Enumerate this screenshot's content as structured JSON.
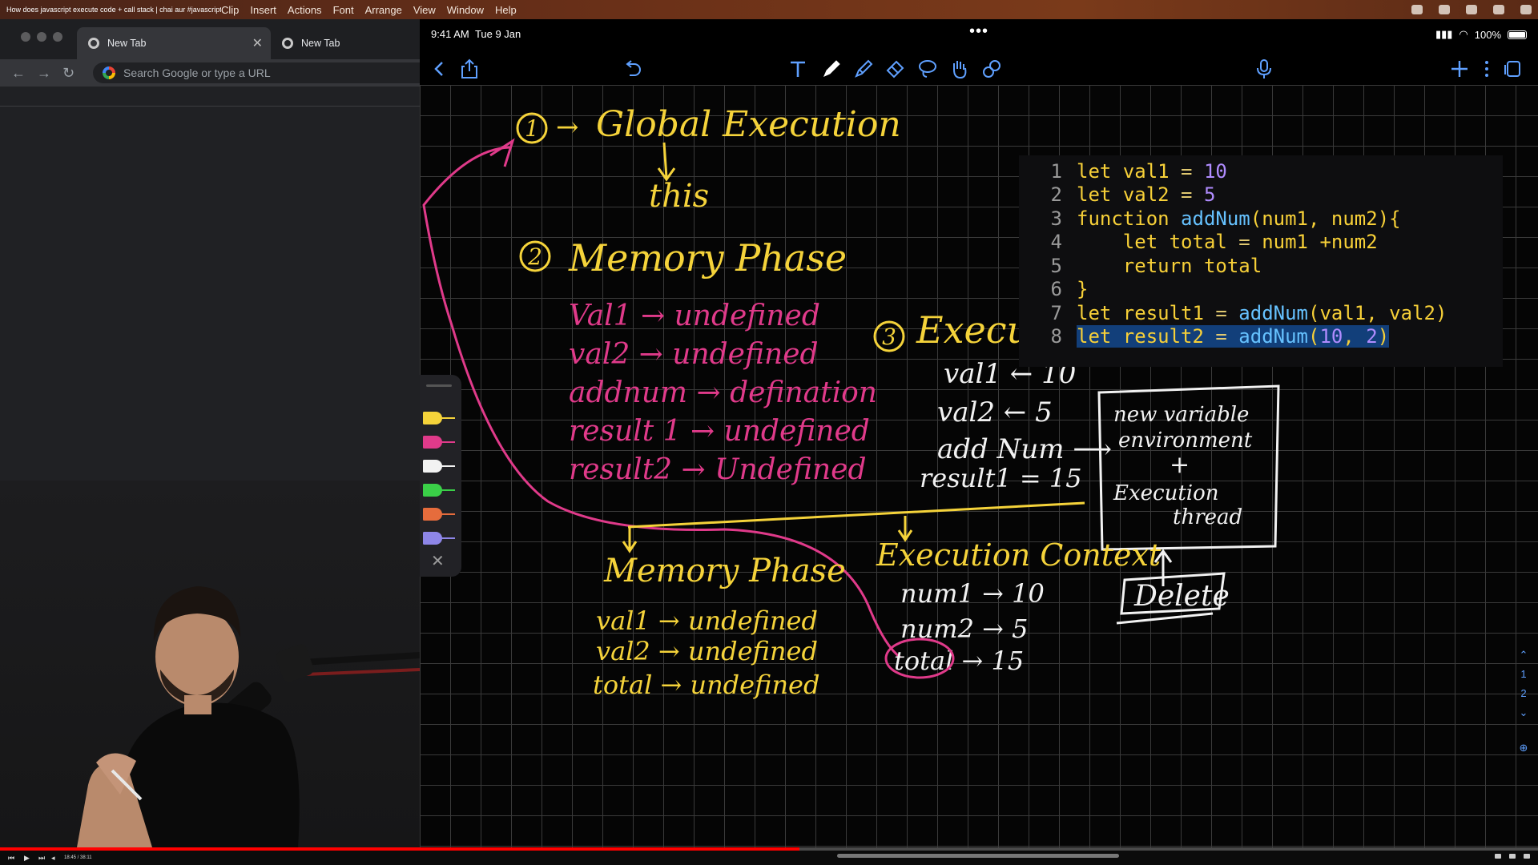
{
  "menubar": {
    "video_title": "How does javascript execute code + call stack | chai aur #javascript",
    "items": [
      "Clip",
      "Insert",
      "Actions",
      "Font",
      "Arrange",
      "View",
      "Window",
      "Help"
    ]
  },
  "chrome": {
    "tabs": [
      {
        "title": "New Tab",
        "active": true
      },
      {
        "title": "New Tab",
        "active": false
      }
    ],
    "omnibox_placeholder": "Search Google or type a URL"
  },
  "ipad": {
    "time": "9:41 AM",
    "date": "Tue 9 Jan",
    "battery": "100%",
    "toolbar_icons": [
      "back-icon",
      "share-icon",
      "undo-icon",
      "text-tool-icon",
      "pen-tool-icon",
      "highlighter-icon",
      "eraser-icon",
      "lasso-icon",
      "hand-icon",
      "shapes-icon",
      "microphone-icon",
      "add-icon",
      "more-icon",
      "pages-icon"
    ]
  },
  "code": {
    "lines": [
      {
        "n": "1",
        "tokens": [
          [
            "kw",
            "let "
          ],
          [
            "id",
            "val1 "
          ],
          [
            "op",
            "= "
          ],
          [
            "num",
            "10"
          ]
        ]
      },
      {
        "n": "2",
        "tokens": [
          [
            "kw",
            "let "
          ],
          [
            "id",
            "val2 "
          ],
          [
            "op",
            "= "
          ],
          [
            "num",
            "5"
          ]
        ]
      },
      {
        "n": "3",
        "tokens": [
          [
            "kw",
            "function "
          ],
          [
            "call",
            "addNum"
          ],
          [
            "id",
            "(num1, num2){"
          ]
        ]
      },
      {
        "n": "4",
        "tokens": [
          [
            "kw",
            "    let "
          ],
          [
            "id",
            "total "
          ],
          [
            "op",
            "= "
          ],
          [
            "id",
            "num1 +num2"
          ]
        ]
      },
      {
        "n": "5",
        "tokens": [
          [
            "kw",
            "    return "
          ],
          [
            "id",
            "total"
          ]
        ]
      },
      {
        "n": "6",
        "tokens": [
          [
            "id",
            "}"
          ]
        ]
      },
      {
        "n": "7",
        "tokens": [
          [
            "kw",
            "let "
          ],
          [
            "id",
            "result1 "
          ],
          [
            "op",
            "= "
          ],
          [
            "call",
            "addNum"
          ],
          [
            "id",
            "(val1, val2)"
          ]
        ]
      },
      {
        "n": "8",
        "tokens": [
          [
            "kw",
            "let "
          ],
          [
            "id",
            "result2 "
          ],
          [
            "op",
            "= "
          ],
          [
            "call",
            "addNum"
          ],
          [
            "id",
            "("
          ],
          [
            "num",
            "10"
          ],
          [
            "id",
            ", "
          ],
          [
            "num",
            "2"
          ],
          [
            "id",
            ")"
          ]
        ],
        "highlight": true
      }
    ]
  },
  "notes": {
    "global_title": "Global Execution",
    "global_num": "1",
    "global_arrow": "→",
    "this_label": "this",
    "memory_title": "Memory Phase",
    "memory_num": "2",
    "memory_items": [
      "Val1 → undefined",
      "val2 → undefined",
      "addnum → defination",
      "result 1 → undefined",
      "result2 → Undefined"
    ],
    "exec_title": "Execution Phase",
    "exec_num": "3",
    "exec_items": [
      "val1 ← 10",
      "val2 ← 5",
      "add Num ⟶",
      "result1 = 15"
    ],
    "box_lines": [
      "new variable",
      "environment",
      "+",
      "Execution",
      "thread"
    ],
    "delete_label": "Delete",
    "memory2_title": "Memory Phase",
    "memory2_items": [
      "val1 → undefined",
      "val2 → undefined",
      "total → undefined"
    ],
    "ctx_title": "Execution Context",
    "ctx_items": [
      "num1 → 10",
      "num2 → 5",
      "total → 15"
    ]
  },
  "page_indicator": [
    "1",
    "2"
  ],
  "player": {
    "timecode": "18:45 / 38:11",
    "progress": 0.52
  },
  "colors": {
    "ink_yellow": "#f5d33a",
    "ink_pink": "#e03a8a",
    "ink_white": "#f2f2f2",
    "accent_blue": "#5fa0ff",
    "code_highlight": "#123f7a"
  }
}
